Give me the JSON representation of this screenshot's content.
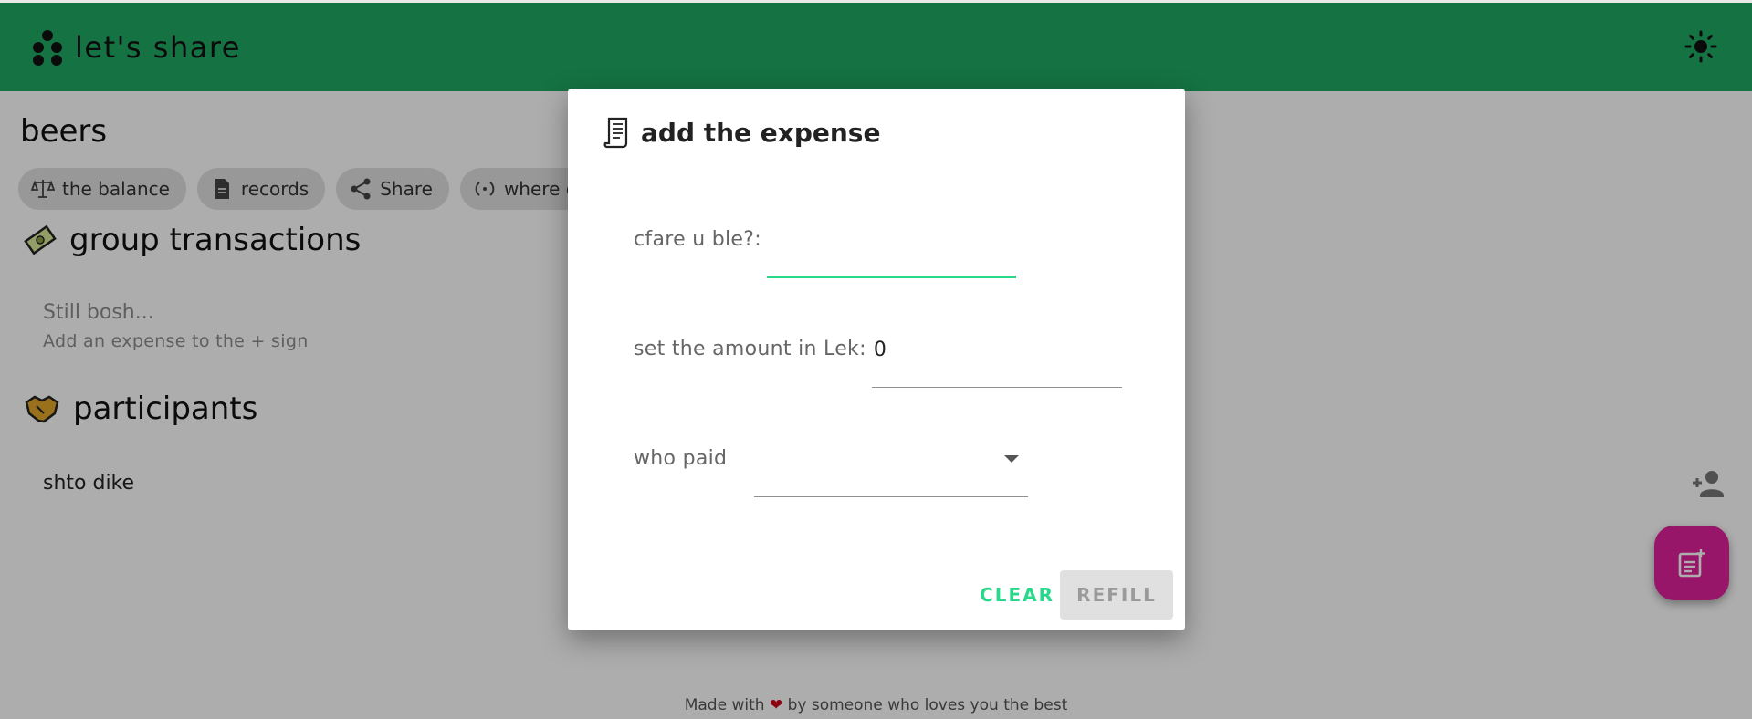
{
  "app": {
    "title": "let's share"
  },
  "group": {
    "name": "beers"
  },
  "chips": [
    {
      "label": "the balance",
      "icon": "scale-icon"
    },
    {
      "label": "records",
      "icon": "document-icon"
    },
    {
      "label": "Share",
      "icon": "share-icon"
    },
    {
      "label": "where do",
      "icon": "cycle-icon"
    }
  ],
  "transactions": {
    "title": "group transactions",
    "empty_title": "Still bosh...",
    "empty_hint": "Add an expense to the + sign"
  },
  "participants": {
    "title": "participants",
    "items": [
      "shto dike"
    ]
  },
  "footer": {
    "before": "Made with",
    "after": "by someone who loves you the best"
  },
  "dialog": {
    "title": "add the expense",
    "what_label": "cfare u ble?:",
    "what_value": "",
    "amount_label": "set the amount in Lek:",
    "amount_value": "0",
    "payer_label": "who paid",
    "payer_value": "",
    "clear_label": "CLEAR",
    "refill_label": "REFILL"
  },
  "colors": {
    "appbar": "#1fa862",
    "accent": "#27d98b",
    "fab": "#e0219b"
  }
}
